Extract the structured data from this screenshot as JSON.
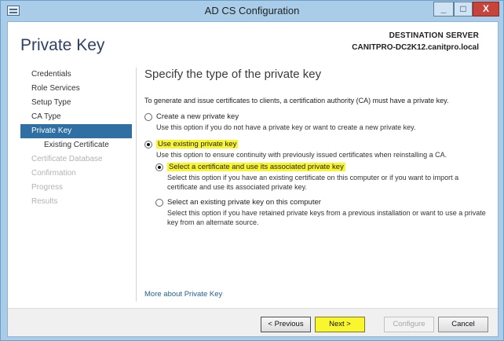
{
  "window": {
    "title": "AD CS Configuration",
    "controls": {
      "minimize": "_",
      "maximize": "□",
      "close": "X"
    }
  },
  "header": {
    "page_title": "Private Key",
    "destination_label": "DESTINATION SERVER",
    "destination_server": "CANITPRO-DC2K12.canitpro.local"
  },
  "nav": {
    "items": [
      {
        "label": "Credentials",
        "state": "normal"
      },
      {
        "label": "Role Services",
        "state": "normal"
      },
      {
        "label": "Setup Type",
        "state": "normal"
      },
      {
        "label": "CA Type",
        "state": "normal"
      },
      {
        "label": "Private Key",
        "state": "active"
      },
      {
        "label": "Existing Certificate",
        "state": "sub"
      },
      {
        "label": "Certificate Database",
        "state": "disabled"
      },
      {
        "label": "Confirmation",
        "state": "disabled"
      },
      {
        "label": "Progress",
        "state": "disabled"
      },
      {
        "label": "Results",
        "state": "disabled"
      }
    ]
  },
  "content": {
    "section_title": "Specify the type of the private key",
    "intro": "To generate and issue certificates to clients, a certification authority (CA) must have a private key.",
    "option_new": {
      "label": "Create a new private key",
      "desc": "Use this option if you do not have a private key or want to create a new private key.",
      "checked": false
    },
    "option_existing": {
      "label": "Use existing private key",
      "desc": "Use this option to ensure continuity with previously issued certificates when reinstalling a CA.",
      "checked": true
    },
    "suboption_cert": {
      "label": "Select a certificate and use its associated private key",
      "desc": "Select this option if you have an existing certificate on this computer or if you want to import a certificate and use its associated private key.",
      "checked": true
    },
    "suboption_key": {
      "label": "Select an existing private key on this computer",
      "desc": "Select this option if you have retained private keys from a previous installation or want to use a private key from an alternate source.",
      "checked": false
    },
    "more_link": "More about Private Key"
  },
  "footer": {
    "previous": "< Previous",
    "next": "Next >",
    "configure": "Configure",
    "cancel": "Cancel"
  },
  "colors": {
    "highlight": "#f9f52e",
    "nav_active": "#2f6fa3",
    "title_bar": "#a9cde8",
    "close_button": "#c7443b"
  }
}
